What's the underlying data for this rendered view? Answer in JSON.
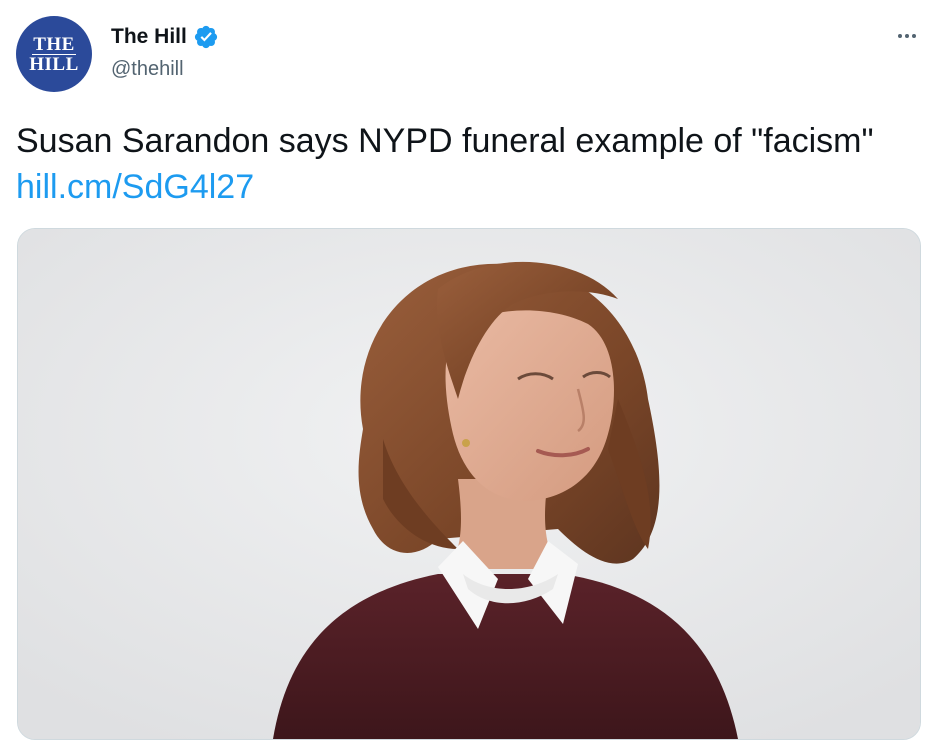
{
  "account": {
    "display_name": "The Hill",
    "handle": "@thehill",
    "verified": true,
    "avatar_logo": [
      "THE",
      "HILL"
    ],
    "avatar_color": "#2b4a9a",
    "verified_color": "#1d9bf0"
  },
  "menu": {
    "more_icon": "more-horizontal-icon"
  },
  "tweet": {
    "text": "Susan Sarandon says NYPD funeral example of \"facism\"",
    "link_text": "hill.cm/SdG4l27",
    "link_color": "#1d9bf0"
  },
  "media": {
    "type": "photo"
  }
}
